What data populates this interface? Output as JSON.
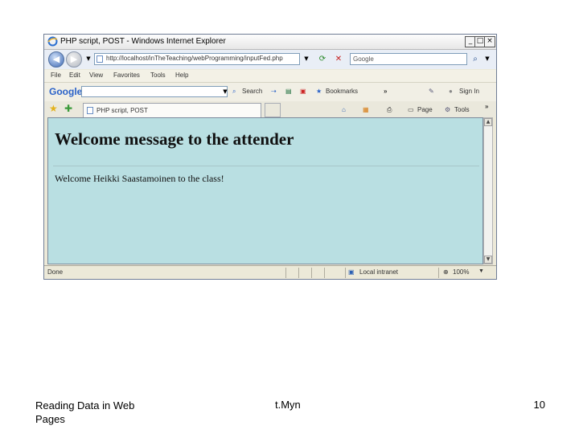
{
  "browser": {
    "window_title": "PHP script, POST - Windows Internet Explorer",
    "url": "http://localhost/inTheTeaching/webProgramming/inputFed.php",
    "search_placeholder": "Google",
    "menu": [
      "File",
      "Edit",
      "View",
      "Favorites",
      "Tools",
      "Help"
    ],
    "google_toolbar": {
      "logo": "Google",
      "search_label": "Search",
      "bookmarks_label": "Bookmarks",
      "signin_label": "Sign In"
    },
    "tab_title": "PHP script, POST",
    "command_bar": {
      "page_label": "Page",
      "tools_label": "Tools"
    },
    "status": {
      "text": "Done",
      "zone": "Local intranet",
      "zoom": "100%"
    }
  },
  "page": {
    "heading": "Welcome message to the attender",
    "message": "Welcome Heikki Saastamoinen to the class!"
  },
  "slide_footer": {
    "left": "Reading Data in Web Pages",
    "center": "t.Myn",
    "page_number": "10"
  },
  "colors": {
    "content_background": "#b9dfe2",
    "title_bar": "#f2f2f2",
    "chrome": "#ece9d8"
  }
}
